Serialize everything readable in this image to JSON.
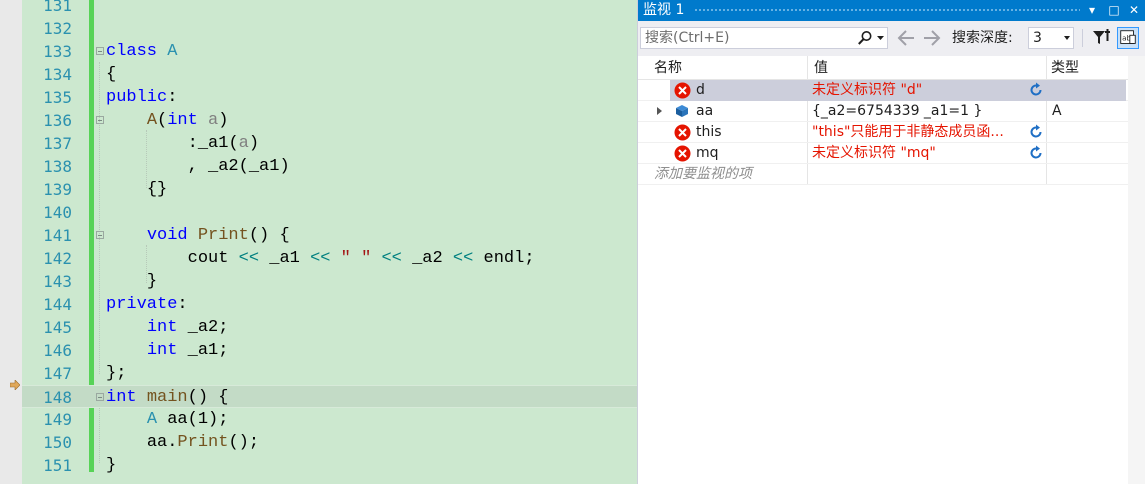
{
  "editor": {
    "lines": [
      {
        "num": "131"
      },
      {
        "num": "132"
      },
      {
        "num": "133"
      },
      {
        "num": "134"
      },
      {
        "num": "135"
      },
      {
        "num": "136"
      },
      {
        "num": "137"
      },
      {
        "num": "138"
      },
      {
        "num": "139"
      },
      {
        "num": "140"
      },
      {
        "num": "141"
      },
      {
        "num": "142"
      },
      {
        "num": "143"
      },
      {
        "num": "144"
      },
      {
        "num": "145"
      },
      {
        "num": "146"
      },
      {
        "num": "147"
      },
      {
        "num": "148"
      },
      {
        "num": "149"
      },
      {
        "num": "150"
      },
      {
        "num": "151"
      }
    ],
    "code": {
      "l133": {
        "kw": "class",
        "name": "A"
      },
      "l134": {
        "brace": "{"
      },
      "l135": {
        "kw": "public",
        "colon": ":"
      },
      "l136": {
        "fn": "A",
        "open": "(",
        "type": "int",
        "param": "a",
        "close": ")"
      },
      "l137": {
        "colon": ":",
        "member": "_a1",
        "open": "(",
        "arg": "a",
        "close": ")"
      },
      "l138": {
        "comma": ",",
        "member": "_a2",
        "open": "(",
        "arg": "_a1",
        "close": ")"
      },
      "l139": {
        "braces": "{}"
      },
      "l141": {
        "kw": "void",
        "fn": "Print",
        "parens": "()",
        "brace": "{"
      },
      "l142": {
        "id1": "cout",
        "op1": "<<",
        "id2": "_a1",
        "op2": "<<",
        "str": "\" \"",
        "op3": "<<",
        "id3": "_a2",
        "op4": "<<",
        "id4": "endl",
        "semi": ";"
      },
      "l143": {
        "brace": "}"
      },
      "l144": {
        "kw": "private",
        "colon": ":"
      },
      "l145": {
        "kw": "int",
        "id": "_a2",
        "semi": ";"
      },
      "l146": {
        "kw": "int",
        "id": "_a1",
        "semi": ";"
      },
      "l147": {
        "end": "};"
      },
      "l148": {
        "kw": "int",
        "fn": "main",
        "parens": "()",
        "brace": "{"
      },
      "l149": {
        "type": "A",
        "id": "aa",
        "open": "(",
        "num": "1",
        "close": ");"
      },
      "l150": {
        "id": "aa",
        "dot": ".",
        "fn": "Print",
        "tail": "();"
      },
      "l151": {
        "brace": "}"
      }
    }
  },
  "watch": {
    "title": "监视 1",
    "title_buttons": [
      "▾",
      "□",
      "✕"
    ],
    "search_placeholder": "搜索(Ctrl+E)",
    "search_depth_label": "搜索深度:",
    "search_depth_value": "3",
    "columns": {
      "name": "名称",
      "value": "值",
      "type": "类型"
    },
    "rows": [
      {
        "name": "d",
        "value": "未定义标识符 \"d\"",
        "type": "",
        "error": true
      },
      {
        "name": "aa",
        "value": "{_a2=6754339 _a1=1 }",
        "type": "A",
        "error": false
      },
      {
        "name": "this",
        "value": "\"this\"只能用于非静态成员函...",
        "type": "",
        "error": true
      },
      {
        "name": "mq",
        "value": "未定义标识符 \"mq\"",
        "type": "",
        "error": true
      }
    ],
    "add_item": "添加要监视的项",
    "colors": {
      "title_bar": "#007acc",
      "error_text": "#e51400",
      "editor_bg": "#cce8cf"
    }
  }
}
